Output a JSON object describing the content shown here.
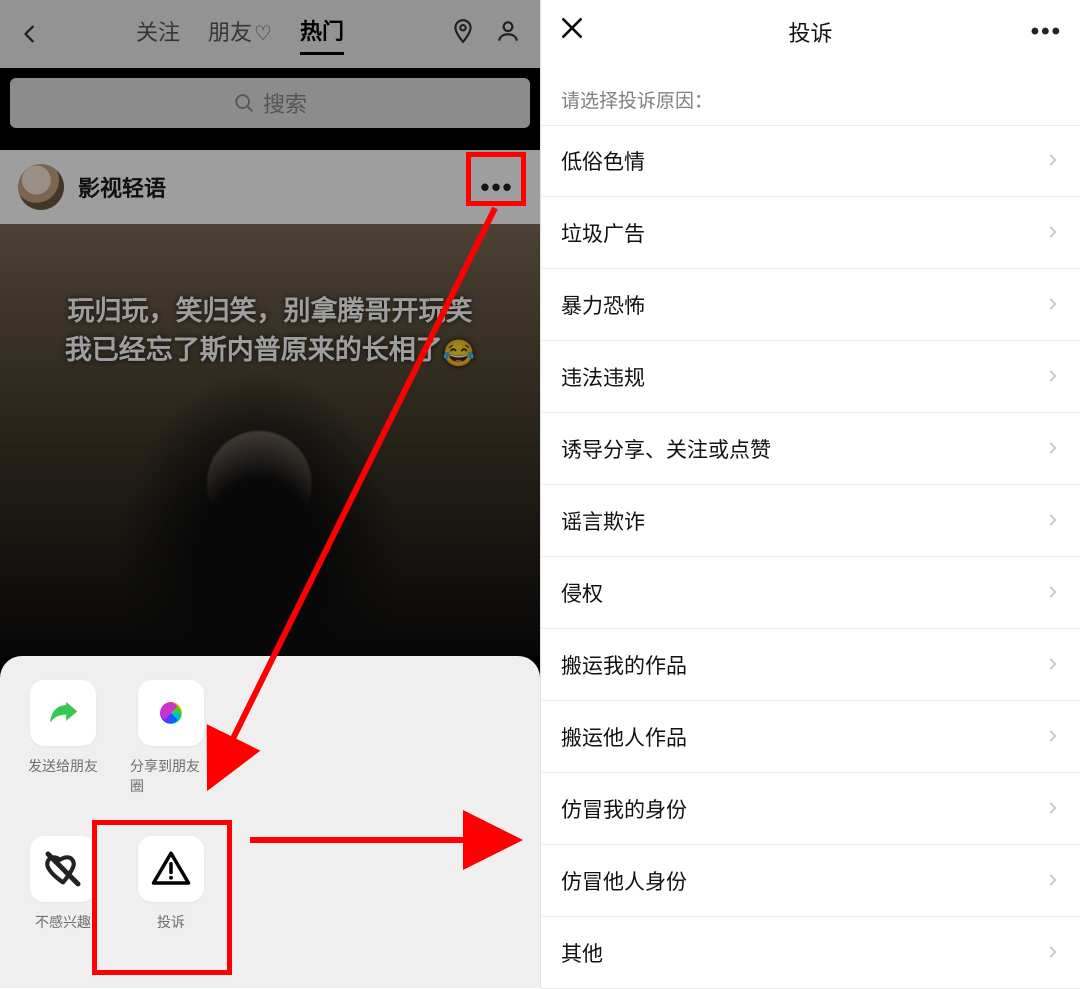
{
  "left": {
    "tabs": {
      "follow": "关注",
      "friends": "朋友",
      "hot": "热门"
    },
    "search_placeholder": "搜索",
    "author": "影视轻语",
    "more_dots": "•••",
    "caption_line1": "玩归玩，笑归笑，别拿腾哥开玩笑",
    "caption_line2": "我已经忘了斯内普原来的长相了",
    "caption_emoji": "😂",
    "sheet": {
      "send_friend": "发送给朋友",
      "share_moments": "分享到朋友圈",
      "not_interested": "不感兴趣",
      "report": "投诉"
    }
  },
  "right": {
    "title": "投诉",
    "more_dots": "•••",
    "prompt": "请选择投诉原因：",
    "reasons": [
      "低俗色情",
      "垃圾广告",
      "暴力恐怖",
      "违法违规",
      "诱导分享、关注或点赞",
      "谣言欺诈",
      "侵权",
      "搬运我的作品",
      "搬运他人作品",
      "仿冒我的身份",
      "仿冒他人身份",
      "其他"
    ]
  }
}
